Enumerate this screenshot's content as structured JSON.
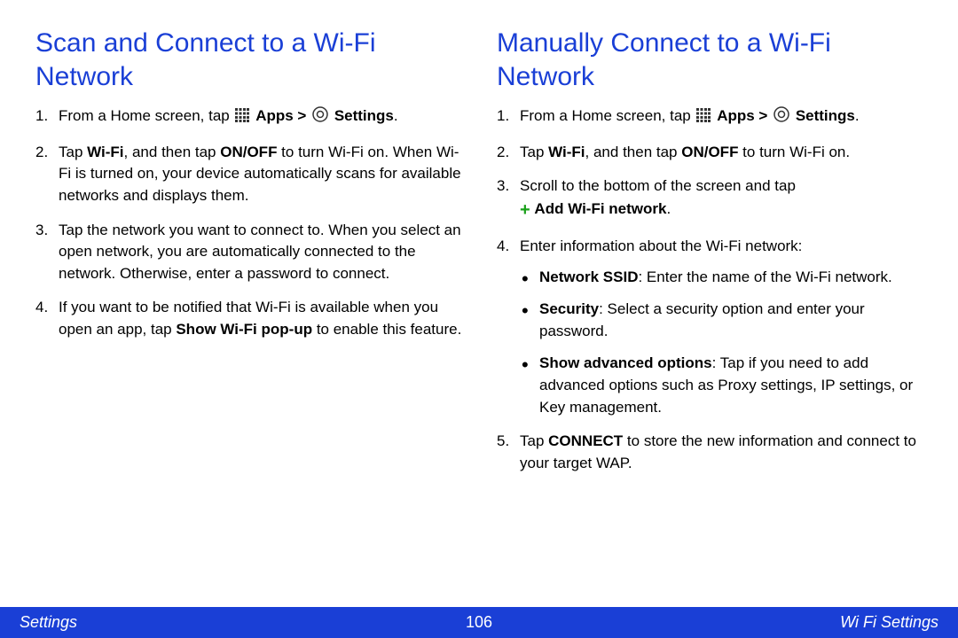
{
  "left": {
    "heading": "Scan and Connect to a Wi-Fi Network",
    "step1_a": "From a Home screen, tap ",
    "step1_apps": "Apps > ",
    "step1_settings": "Settings",
    "step1_end": ".",
    "step2_a": "Tap ",
    "step2_wifi": "Wi-Fi",
    "step2_b": ", and then tap ",
    "step2_onoff": "ON/OFF",
    "step2_c": " to turn Wi-Fi on. When Wi-Fi is turned on, your device automatically scans for available networks and displays them.",
    "step3": "Tap the network you want to connect to. When you select an open network, you are automatically connected to the network. Otherwise, enter a password to connect.",
    "step4_a": "If you want to be notified that Wi-Fi is available when you open an app, tap ",
    "step4_show": "Show Wi-Fi pop-up",
    "step4_b": " to enable this feature."
  },
  "right": {
    "heading": "Manually Connect to a Wi‑Fi Network",
    "step1_a": "From a Home screen, tap ",
    "step1_apps": "Apps > ",
    "step1_settings": "Settings",
    "step1_end": ".",
    "step2_a": "Tap ",
    "step2_wifi": "Wi-Fi",
    "step2_b": ", and then tap ",
    "step2_onoff": "ON/OFF",
    "step2_c": " to turn Wi-Fi on.",
    "step3_a": "Scroll to the bottom of the screen and tap ",
    "step3_add": "Add Wi-Fi network",
    "step3_end": ".",
    "step4": "Enter information about the Wi-Fi network:",
    "b1_label": "Network SSID",
    "b1_text": ": Enter the name of the Wi-Fi network.",
    "b2_label": "Security",
    "b2_text": ": Select a security option and enter your password.",
    "b3_label": "Show advanced options",
    "b3_text": ": Tap if you need to add advanced options such as Proxy settings, IP settings, or Key management.",
    "step5_a": "Tap ",
    "step5_connect": "CONNECT",
    "step5_b": " to store the new information and connect to your target WAP."
  },
  "footer": {
    "left": "Settings",
    "center": "106",
    "right": "Wi Fi Settings"
  }
}
